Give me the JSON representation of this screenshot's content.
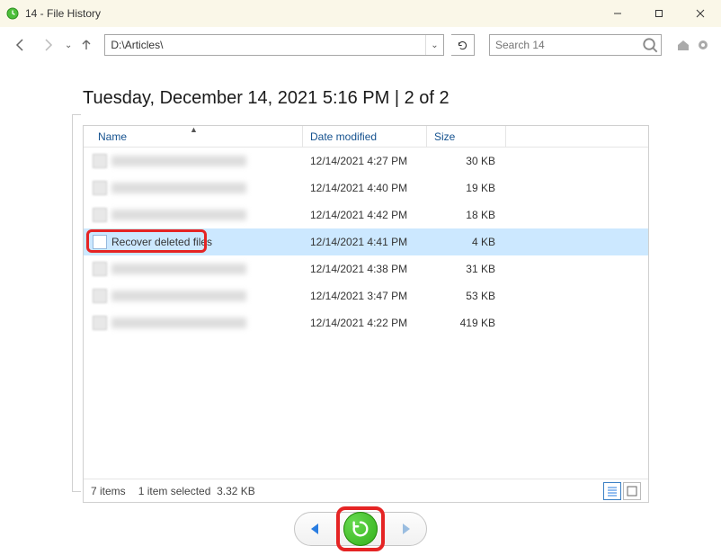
{
  "window": {
    "title": "14 - File History"
  },
  "toolbar": {
    "path_text": "D:\\Articles\\",
    "search_placeholder": "Search 14"
  },
  "heading": "Tuesday, December 14, 2021 5:16 PM   |   2 of 2",
  "columns": {
    "name": "Name",
    "date": "Date modified",
    "size": "Size"
  },
  "rows": [
    {
      "name": "",
      "blur": true,
      "date": "12/14/2021 4:27 PM",
      "size": "30 KB",
      "selected": false
    },
    {
      "name": "",
      "blur": true,
      "date": "12/14/2021 4:40 PM",
      "size": "19 KB",
      "selected": false
    },
    {
      "name": "",
      "blur": true,
      "date": "12/14/2021 4:42 PM",
      "size": "18 KB",
      "selected": false
    },
    {
      "name": "Recover deleted files",
      "blur": false,
      "date": "12/14/2021 4:41 PM",
      "size": "4 KB",
      "selected": true,
      "highlight": true
    },
    {
      "name": "",
      "blur": true,
      "date": "12/14/2021 4:38 PM",
      "size": "31 KB",
      "selected": false
    },
    {
      "name": "",
      "blur": true,
      "date": "12/14/2021 3:47 PM",
      "size": "53 KB",
      "selected": false
    },
    {
      "name": "",
      "blur": true,
      "date": "12/14/2021 4:22 PM",
      "size": "419 KB",
      "selected": false
    }
  ],
  "status": {
    "items": "7 items",
    "selected": "1 item selected",
    "size": "3.32 KB"
  }
}
